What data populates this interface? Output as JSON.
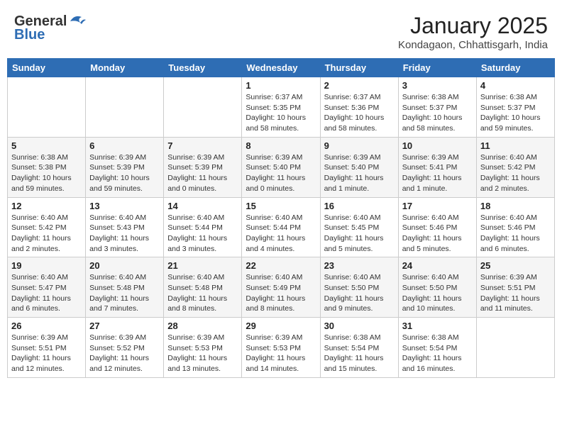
{
  "header": {
    "logo_general": "General",
    "logo_blue": "Blue",
    "month": "January 2025",
    "location": "Kondagaon, Chhattisgarh, India"
  },
  "weekdays": [
    "Sunday",
    "Monday",
    "Tuesday",
    "Wednesday",
    "Thursday",
    "Friday",
    "Saturday"
  ],
  "weeks": [
    [
      {
        "day": "",
        "info": ""
      },
      {
        "day": "",
        "info": ""
      },
      {
        "day": "",
        "info": ""
      },
      {
        "day": "1",
        "info": "Sunrise: 6:37 AM\nSunset: 5:35 PM\nDaylight: 10 hours\nand 58 minutes."
      },
      {
        "day": "2",
        "info": "Sunrise: 6:37 AM\nSunset: 5:36 PM\nDaylight: 10 hours\nand 58 minutes."
      },
      {
        "day": "3",
        "info": "Sunrise: 6:38 AM\nSunset: 5:37 PM\nDaylight: 10 hours\nand 58 minutes."
      },
      {
        "day": "4",
        "info": "Sunrise: 6:38 AM\nSunset: 5:37 PM\nDaylight: 10 hours\nand 59 minutes."
      }
    ],
    [
      {
        "day": "5",
        "info": "Sunrise: 6:38 AM\nSunset: 5:38 PM\nDaylight: 10 hours\nand 59 minutes."
      },
      {
        "day": "6",
        "info": "Sunrise: 6:39 AM\nSunset: 5:39 PM\nDaylight: 10 hours\nand 59 minutes."
      },
      {
        "day": "7",
        "info": "Sunrise: 6:39 AM\nSunset: 5:39 PM\nDaylight: 11 hours\nand 0 minutes."
      },
      {
        "day": "8",
        "info": "Sunrise: 6:39 AM\nSunset: 5:40 PM\nDaylight: 11 hours\nand 0 minutes."
      },
      {
        "day": "9",
        "info": "Sunrise: 6:39 AM\nSunset: 5:40 PM\nDaylight: 11 hours\nand 1 minute."
      },
      {
        "day": "10",
        "info": "Sunrise: 6:39 AM\nSunset: 5:41 PM\nDaylight: 11 hours\nand 1 minute."
      },
      {
        "day": "11",
        "info": "Sunrise: 6:40 AM\nSunset: 5:42 PM\nDaylight: 11 hours\nand 2 minutes."
      }
    ],
    [
      {
        "day": "12",
        "info": "Sunrise: 6:40 AM\nSunset: 5:42 PM\nDaylight: 11 hours\nand 2 minutes."
      },
      {
        "day": "13",
        "info": "Sunrise: 6:40 AM\nSunset: 5:43 PM\nDaylight: 11 hours\nand 3 minutes."
      },
      {
        "day": "14",
        "info": "Sunrise: 6:40 AM\nSunset: 5:44 PM\nDaylight: 11 hours\nand 3 minutes."
      },
      {
        "day": "15",
        "info": "Sunrise: 6:40 AM\nSunset: 5:44 PM\nDaylight: 11 hours\nand 4 minutes."
      },
      {
        "day": "16",
        "info": "Sunrise: 6:40 AM\nSunset: 5:45 PM\nDaylight: 11 hours\nand 5 minutes."
      },
      {
        "day": "17",
        "info": "Sunrise: 6:40 AM\nSunset: 5:46 PM\nDaylight: 11 hours\nand 5 minutes."
      },
      {
        "day": "18",
        "info": "Sunrise: 6:40 AM\nSunset: 5:46 PM\nDaylight: 11 hours\nand 6 minutes."
      }
    ],
    [
      {
        "day": "19",
        "info": "Sunrise: 6:40 AM\nSunset: 5:47 PM\nDaylight: 11 hours\nand 6 minutes."
      },
      {
        "day": "20",
        "info": "Sunrise: 6:40 AM\nSunset: 5:48 PM\nDaylight: 11 hours\nand 7 minutes."
      },
      {
        "day": "21",
        "info": "Sunrise: 6:40 AM\nSunset: 5:48 PM\nDaylight: 11 hours\nand 8 minutes."
      },
      {
        "day": "22",
        "info": "Sunrise: 6:40 AM\nSunset: 5:49 PM\nDaylight: 11 hours\nand 8 minutes."
      },
      {
        "day": "23",
        "info": "Sunrise: 6:40 AM\nSunset: 5:50 PM\nDaylight: 11 hours\nand 9 minutes."
      },
      {
        "day": "24",
        "info": "Sunrise: 6:40 AM\nSunset: 5:50 PM\nDaylight: 11 hours\nand 10 minutes."
      },
      {
        "day": "25",
        "info": "Sunrise: 6:39 AM\nSunset: 5:51 PM\nDaylight: 11 hours\nand 11 minutes."
      }
    ],
    [
      {
        "day": "26",
        "info": "Sunrise: 6:39 AM\nSunset: 5:51 PM\nDaylight: 11 hours\nand 12 minutes."
      },
      {
        "day": "27",
        "info": "Sunrise: 6:39 AM\nSunset: 5:52 PM\nDaylight: 11 hours\nand 12 minutes."
      },
      {
        "day": "28",
        "info": "Sunrise: 6:39 AM\nSunset: 5:53 PM\nDaylight: 11 hours\nand 13 minutes."
      },
      {
        "day": "29",
        "info": "Sunrise: 6:39 AM\nSunset: 5:53 PM\nDaylight: 11 hours\nand 14 minutes."
      },
      {
        "day": "30",
        "info": "Sunrise: 6:38 AM\nSunset: 5:54 PM\nDaylight: 11 hours\nand 15 minutes."
      },
      {
        "day": "31",
        "info": "Sunrise: 6:38 AM\nSunset: 5:54 PM\nDaylight: 11 hours\nand 16 minutes."
      },
      {
        "day": "",
        "info": ""
      }
    ]
  ]
}
